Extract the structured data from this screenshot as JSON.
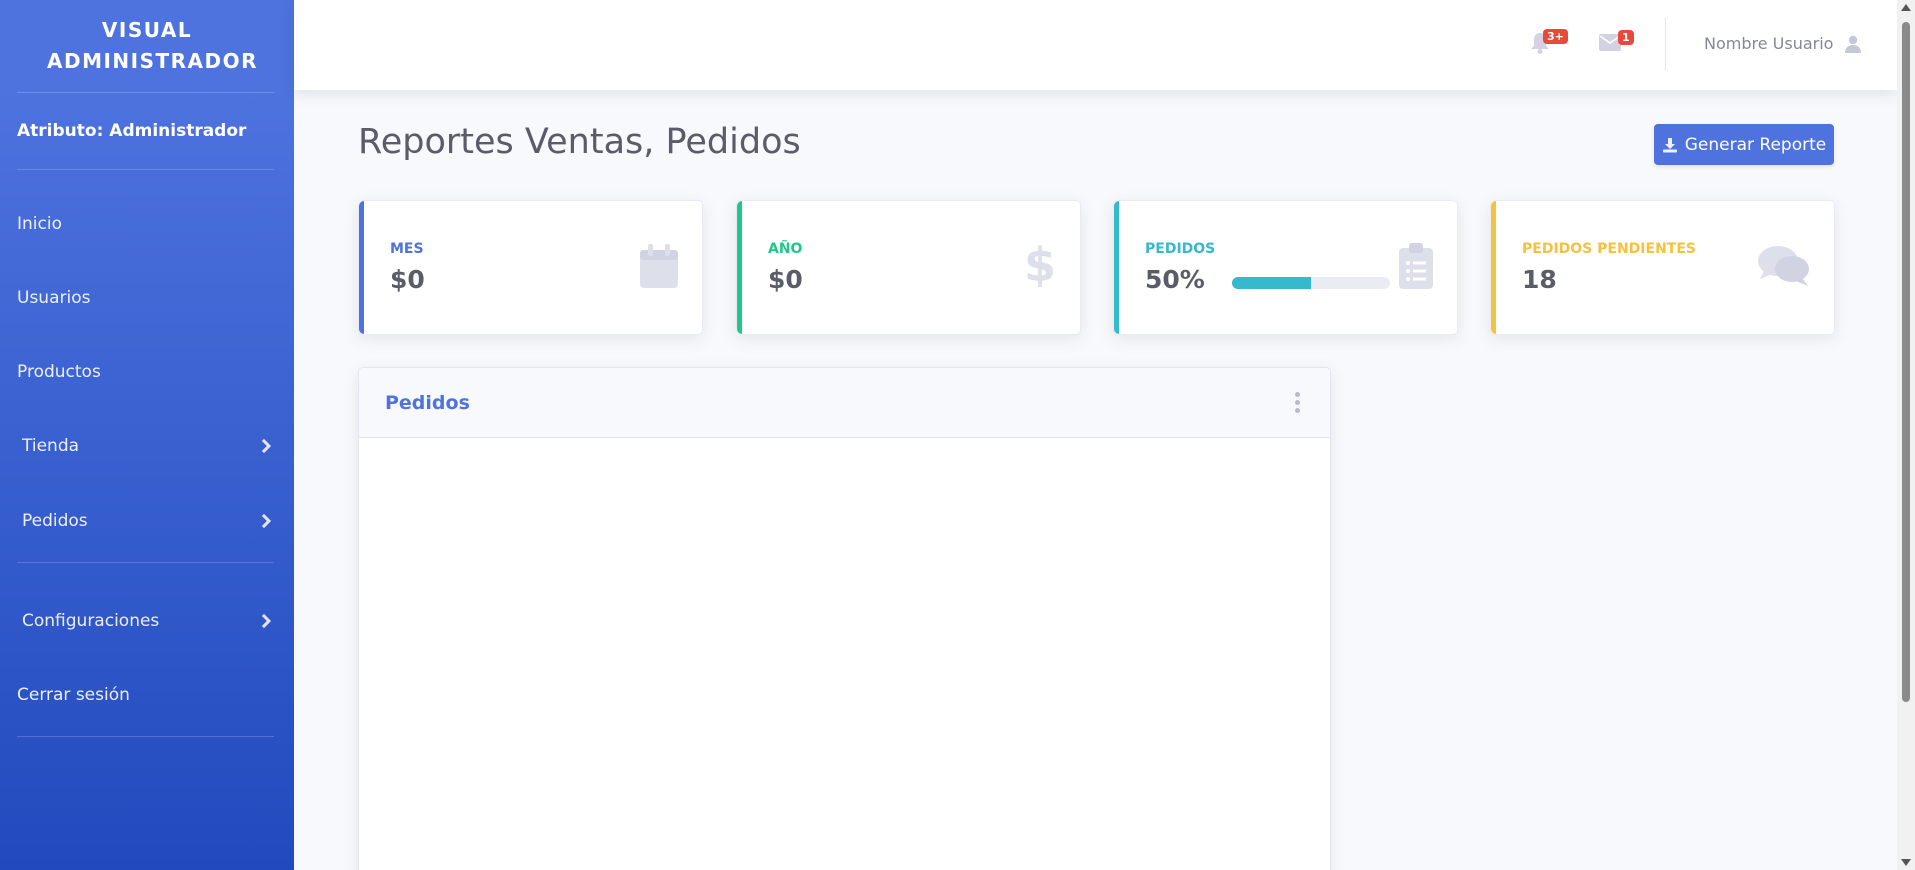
{
  "sidebar": {
    "brand": "VISUAL ADMINISTRADOR",
    "role": "Atributo: Administrador",
    "items": [
      {
        "label": "Inicio"
      },
      {
        "label": "Usuarios"
      },
      {
        "label": "Productos"
      },
      {
        "label": "Tienda"
      },
      {
        "label": "Pedidos"
      },
      {
        "label": "Configuraciones"
      },
      {
        "label": "Cerrar sesión"
      }
    ]
  },
  "topbar": {
    "alerts_badge": "3+",
    "messages_badge": "1",
    "user_name": "Nombre Usuario"
  },
  "main": {
    "title": "Reportes Ventas, Pedidos",
    "generate_button": "Generar Reporte",
    "cards": [
      {
        "label": "MES",
        "value": "$0",
        "color": "#4e73df",
        "icon": "calendar-icon"
      },
      {
        "label": "AÑO",
        "value": "$0",
        "color": "#1cc88a",
        "icon": "dollar-icon"
      },
      {
        "label": "PEDIDOS",
        "value": "50%",
        "progress": 0.5,
        "color": "#36b9cc",
        "icon": "clipboard-list-icon"
      },
      {
        "label": "PEDIDOS PENDIENTES",
        "value": "18",
        "color": "#f6c23e",
        "icon": "comments-icon"
      }
    ],
    "panel": {
      "title": "Pedidos"
    }
  },
  "colors": {
    "primary": "#4e73df",
    "success": "#1cc88a",
    "info": "#36b9cc",
    "warning": "#f6c23e",
    "danger": "#e74a3b"
  }
}
